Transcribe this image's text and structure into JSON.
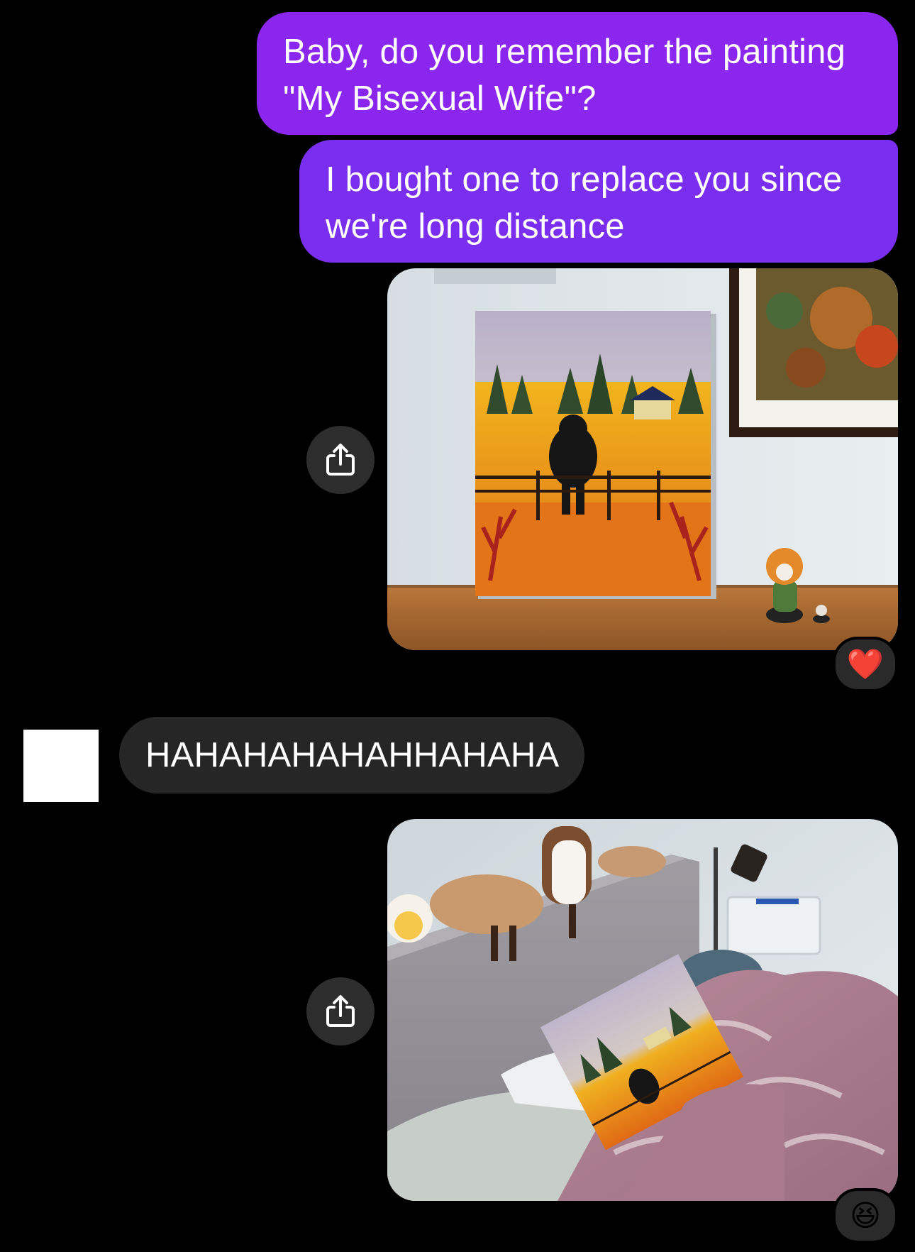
{
  "conversation": {
    "messages": [
      {
        "direction": "outgoing",
        "type": "text",
        "text": "Baby, do you remember the painting\n\"My Bisexual Wife\"?"
      },
      {
        "direction": "outgoing",
        "type": "text",
        "text": "I bought one to replace you since\nwe're long distance"
      },
      {
        "direction": "outgoing",
        "type": "image",
        "image_subject": "painting-on-shelf",
        "share_icon": "share-icon",
        "reaction": "❤️"
      },
      {
        "direction": "incoming",
        "type": "text",
        "text": "HAHAHAHAHAHHAHAHA"
      },
      {
        "direction": "outgoing",
        "type": "image",
        "image_subject": "painting-in-bed",
        "share_icon": "share-icon",
        "reaction": "😆"
      }
    ]
  },
  "colors": {
    "background": "#000000",
    "outgoing_bubble": "#8a26ee",
    "incoming_bubble": "#262626",
    "share_button": "#2d2d2d",
    "reaction_badge": "#2a2a2a"
  }
}
